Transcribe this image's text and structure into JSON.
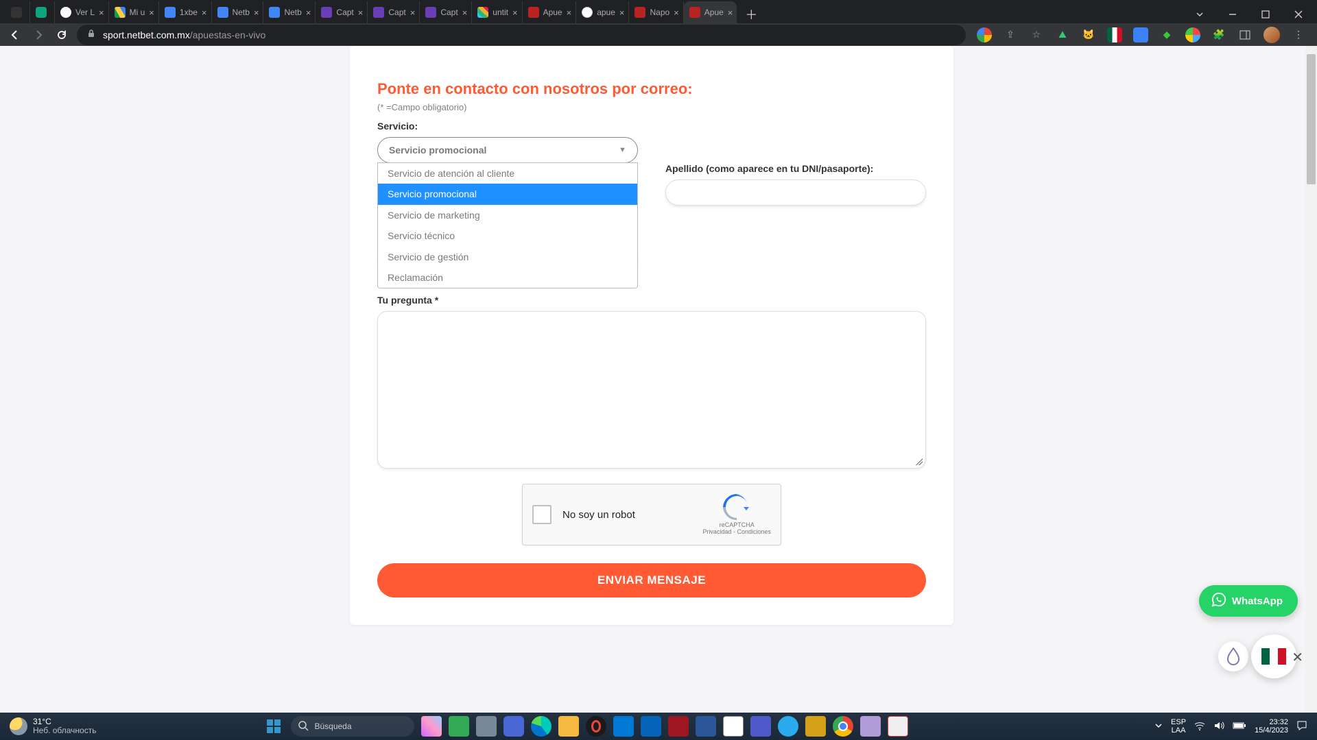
{
  "browser": {
    "tabs": [
      {
        "title": "",
        "favicon": "#333"
      },
      {
        "title": "",
        "favicon": "#10a37f"
      },
      {
        "title": "Ver L",
        "favicon": "#fff"
      },
      {
        "title": "Mi u",
        "favicon": "#0f9d58"
      },
      {
        "title": "1xbe",
        "favicon": "#4285f4"
      },
      {
        "title": "Netb",
        "favicon": "#4285f4"
      },
      {
        "title": "Netb",
        "favicon": "#4285f4"
      },
      {
        "title": "Capt",
        "favicon": "#6a3fb5"
      },
      {
        "title": "Capt",
        "favicon": "#6a3fb5"
      },
      {
        "title": "Capt",
        "favicon": "#6a3fb5"
      },
      {
        "title": "untit",
        "favicon": "#36c"
      },
      {
        "title": "Apue",
        "favicon": "#b22"
      },
      {
        "title": "apue",
        "favicon": "#fff"
      },
      {
        "title": "Napo",
        "favicon": "#b22"
      },
      {
        "title": "Apue",
        "favicon": "#b22",
        "active": true
      }
    ],
    "url_host": "sport.netbet.com.mx",
    "url_path": "/apuestas-en-vivo"
  },
  "form": {
    "title": "Ponte en contacto con nosotros por correo:",
    "subtitle": "(* =Campo obligatorio)",
    "service_label": "Servicio:",
    "service_selected": "Servicio promocional",
    "service_options": [
      "Servicio de atención al cliente",
      "Servicio promocional",
      "Servicio de marketing",
      "Servicio técnico",
      "Servicio de gestión",
      "Reclamación"
    ],
    "lastname_label": "Apellido (como aparece en tu DNI/pasaporte):",
    "question_label": "Tu pregunta *",
    "recaptcha_text": "No soy un robot",
    "recaptcha_brand": "reCAPTCHA",
    "recaptcha_links": "Privacidad - Condiciones",
    "submit": "ENVIAR MENSAJE"
  },
  "floating": {
    "whatsapp": "WhatsApp"
  },
  "taskbar": {
    "temp": "31°C",
    "weather_desc": "Неб. облачность",
    "search_placeholder": "Búsqueda",
    "lang1": "ESP",
    "lang2": "LAA",
    "time": "23:32",
    "date": "15/4/2023"
  }
}
